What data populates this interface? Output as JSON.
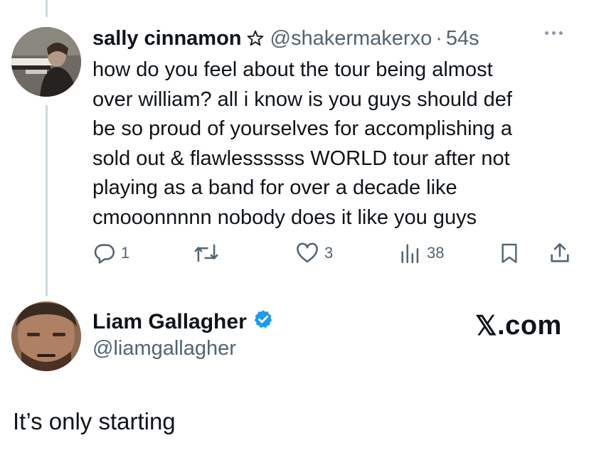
{
  "quoted_tweet": {
    "display_name": "sally cinnamon",
    "handle": "@shakermakerxo",
    "separator": "·",
    "time": "54s",
    "text_lines": [
      "how do you feel about the tour being almost",
      "over william? all i know is you guys should def",
      "be so proud of yourselves for accomplishing a",
      "sold out & flawlessssss WORLD tour after not",
      "playing as a band for over a decade like",
      "cmooonnnnn nobody does it like you guys"
    ],
    "stats": {
      "replies": "1",
      "likes": "3",
      "views": "38"
    }
  },
  "reply": {
    "display_name": "Liam Gallagher",
    "handle": "@liamgallagher",
    "verified": true,
    "text": "It’s only starting"
  },
  "watermark": {
    "logo_letter": "𝕏",
    "suffix": ".com"
  },
  "icons": [
    "star-icon",
    "more-icon",
    "reply-icon",
    "retweet-icon",
    "like-icon",
    "views-icon",
    "bookmark-icon",
    "share-icon",
    "verified-badge-icon"
  ],
  "colors": {
    "text_primary": "#0f1419",
    "text_secondary": "#536471",
    "thread_line": "#cfd9de",
    "verified_blue": "#1d9bf0"
  }
}
